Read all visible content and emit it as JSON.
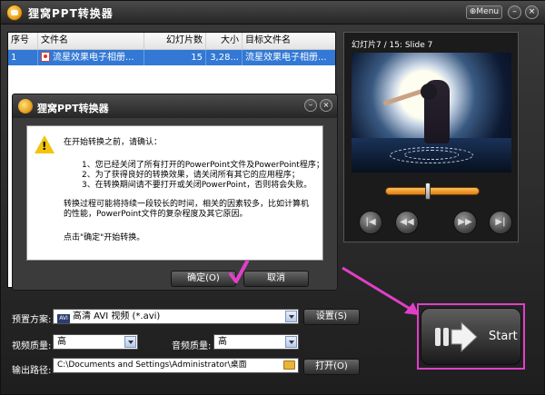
{
  "app": {
    "title": "狸窝PPT转换器",
    "menu_label": "Menu",
    "minimize": "–",
    "close": "×"
  },
  "table": {
    "columns": [
      "序号",
      "文件名",
      "幻灯片数",
      "大小",
      "目标文件名"
    ],
    "rows": [
      {
        "index": "1",
        "filename": "流星效果电子相册...",
        "slides": "15",
        "size": "3,28...",
        "target": "流星效果电子相册..."
      }
    ]
  },
  "preview": {
    "slide_info": "幻灯片7 / 15: Slide 7",
    "progress": 0.45,
    "controls": {
      "first": "|◀",
      "prev": "◀◀",
      "next": "▶▶",
      "last": "▶|"
    }
  },
  "dialog": {
    "title": "狸窝PPT转换器",
    "minimize": "–",
    "close": "×",
    "lines": [
      "在开始转换之前，请确认：",
      "1、您已经关闭了所有打开的PowerPoint文件及PowerPoint程序；",
      "2、为了获得良好的转换效果，请关闭所有其它的应用程序；",
      "3、在转换期间请不要打开或关闭PowerPoint，否则将会失败。",
      "转换过程可能将持续一段较长的时间，相关的因素较多，比如计算机",
      "的性能，PowerPoint文件的复杂程度及其它原因。",
      "点击\"确定\"开始转换。"
    ],
    "ok_label": "确定(O)",
    "cancel_label": "取消"
  },
  "settings": {
    "preset_label": "预置方案:",
    "preset_icon": "AVI",
    "preset_value": "高清 AVI 视频 (*.avi)",
    "settings_button": "设置(S)",
    "video_quality_label": "视频质量:",
    "video_quality_value": "高",
    "audio_quality_label": "音频质量:",
    "audio_quality_value": "高",
    "output_label": "输出路径:",
    "output_path": "C:\\Documents and Settings\\Administrator\\桌面",
    "open_button": "打开(O)",
    "start_label": "Start"
  },
  "colors": {
    "selection": "#3278d4",
    "annotation": "#e040c8",
    "slider": "#f0a030"
  }
}
